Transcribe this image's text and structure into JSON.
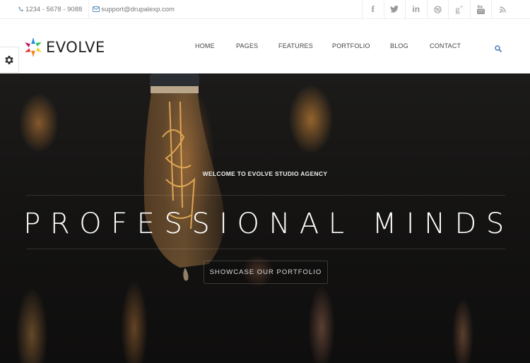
{
  "topbar": {
    "phone": "1234 - 5678 - 9088",
    "email": "support@drupalexp.com",
    "social": [
      {
        "icon": "facebook-icon",
        "glyph": "f"
      },
      {
        "icon": "twitter-icon",
        "glyph": ""
      },
      {
        "icon": "linkedin-icon",
        "glyph": "in"
      },
      {
        "icon": "dribbble-icon",
        "glyph": ""
      },
      {
        "icon": "google-plus-icon",
        "glyph": "g+"
      },
      {
        "icon": "youtube-icon",
        "glyph": ""
      },
      {
        "icon": "rss-icon",
        "glyph": ""
      }
    ]
  },
  "header": {
    "logo_text": "EVOLVE",
    "nav": [
      "HOME",
      "PAGES",
      "FEATURES",
      "PORTFOLIO",
      "BLOG",
      "CONTACT"
    ],
    "accent_color": "#4a7fb5"
  },
  "hero": {
    "welcome": "WELCOME TO EVOLVE STUDIO AGENCY",
    "headline": "PROFESSIONAL MINDS",
    "cta_label": "SHOWCASE OUR PORTFOLIO"
  }
}
